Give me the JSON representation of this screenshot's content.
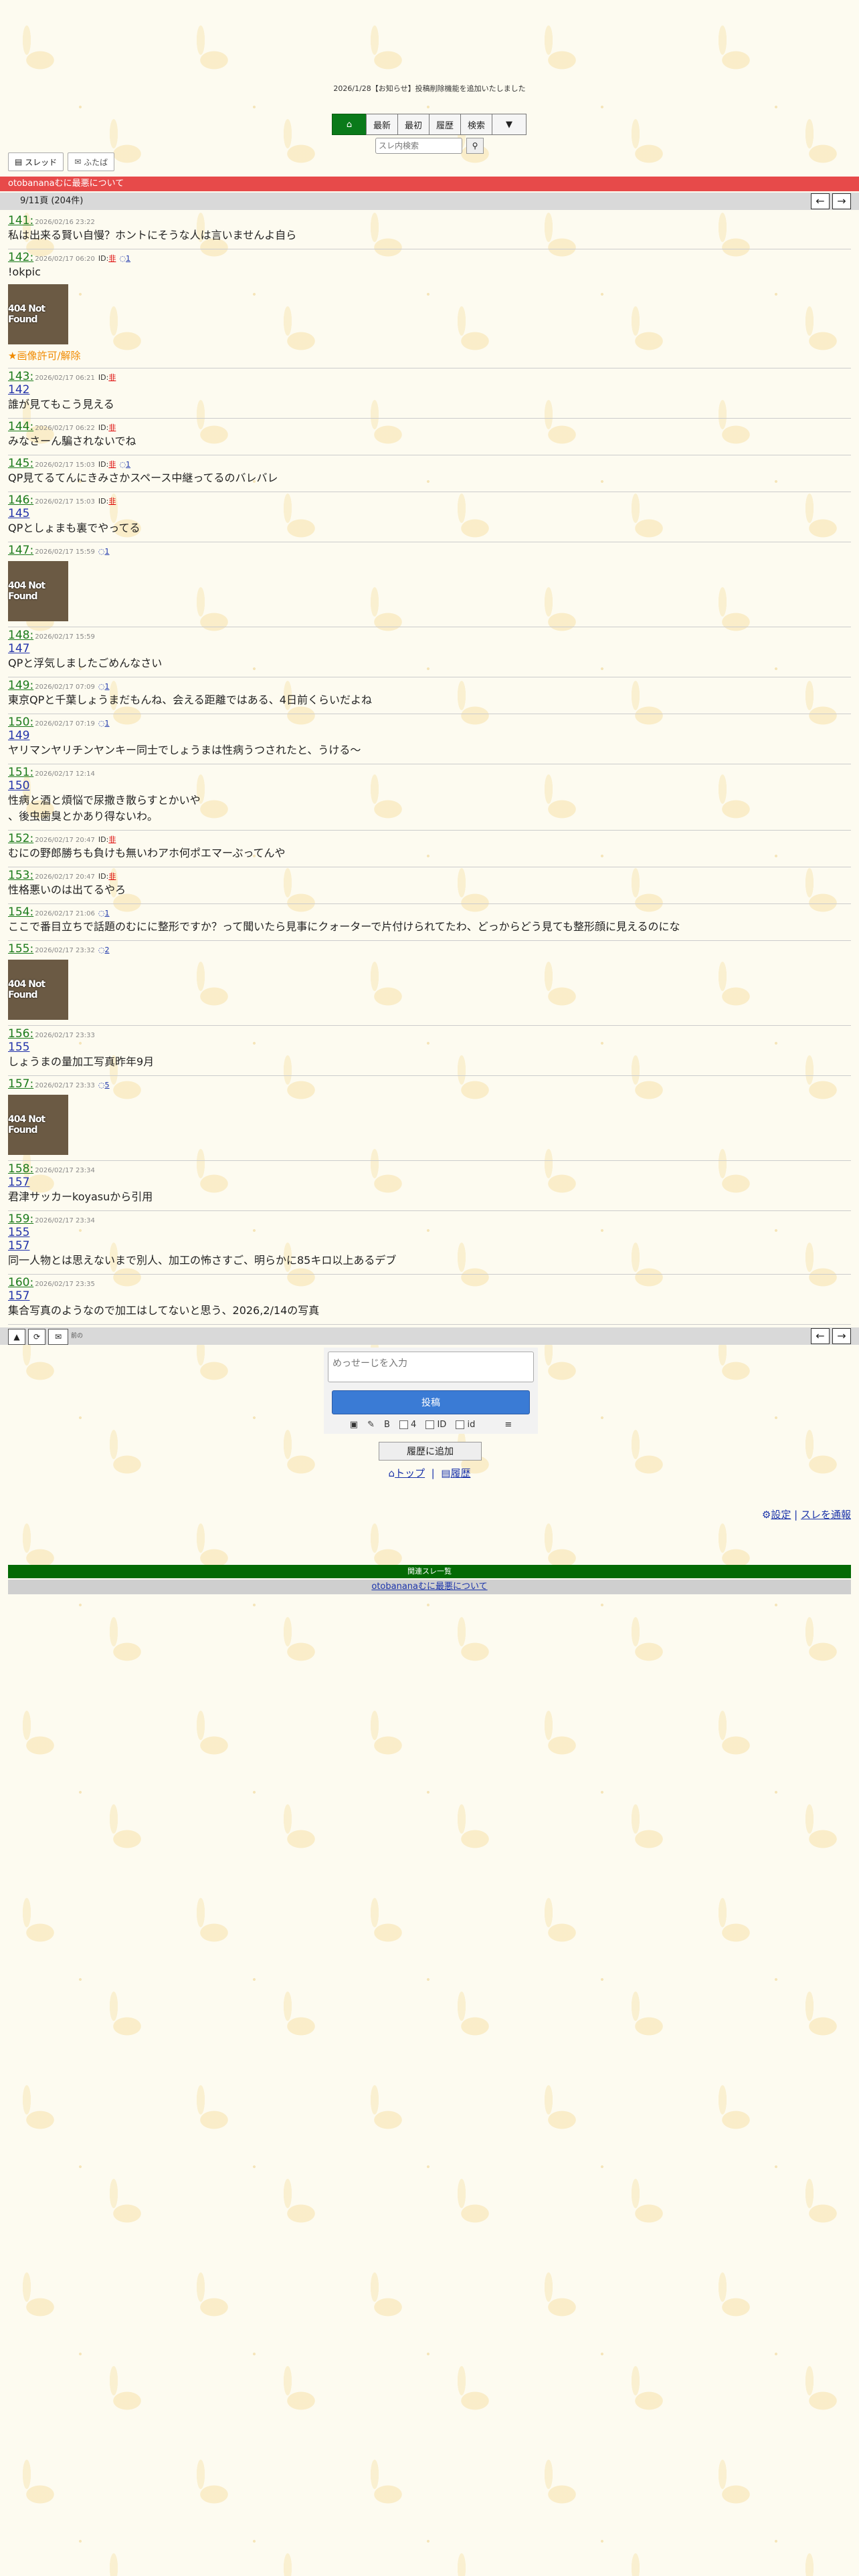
{
  "notice": "2026/1/28【お知らせ】投稿削除機能を追加いたしました",
  "nav": {
    "latest": "最新",
    "first": "最初",
    "history": "履歴",
    "search": "検索",
    "more": "▼"
  },
  "search": {
    "placeholder": "スレ内検索"
  },
  "subnav": {
    "thread": "スレッド",
    "board": "ふたば"
  },
  "thread": {
    "title": "otobananaむに最悪について",
    "page_info": "9/11頁 (204件)"
  },
  "posts": [
    {
      "num": "141:",
      "date": "2026/02/16 23:22",
      "body": "私は出来る賢い自慢？ホントにそうな人は言いませんよ自ら"
    },
    {
      "num": "142:",
      "date": "2026/02/17 06:20",
      "id": "ID:",
      "idv": "非",
      "comments": "1",
      "body": "!okpic",
      "image": "404 Not Found",
      "imgnote": "★画像許可/解除"
    },
    {
      "num": "143:",
      "date": "2026/02/17 06:21",
      "id": "ID:",
      "idv": "非",
      "anchor": "142",
      "body": "誰が見てもこう見える"
    },
    {
      "num": "144:",
      "date": "2026/02/17 06:22",
      "id": "ID:",
      "idv": "非",
      "body": "みなさーん騙されないでね"
    },
    {
      "num": "145:",
      "date": "2026/02/17 15:03",
      "id": "ID:",
      "idv": "非",
      "comments": "1",
      "body": "QP見てるてんにきみさかスペース中継ってるのバレバレ"
    },
    {
      "num": "146:",
      "date": "2026/02/17 15:03",
      "id": "ID:",
      "idv": "非",
      "anchor": "145",
      "body": "QPとしょまも裏でやってる"
    },
    {
      "num": "147:",
      "date": "2026/02/17 15:59",
      "comments": "1",
      "image": "404 Not Found"
    },
    {
      "num": "148:",
      "date": "2026/02/17 15:59",
      "anchor": "147",
      "body": "QPと浮気しましたごめんなさい"
    },
    {
      "num": "149:",
      "date": "2026/02/17 07:09",
      "comments": "1",
      "body": "東京QPと千葉しょうまだもんね、会える距離ではある、4日前くらいだよね"
    },
    {
      "num": "150:",
      "date": "2026/02/17 07:19",
      "comments": "1",
      "anchor": "149",
      "body": "ヤリマンヤリチンヤンキー同士でしょうまは性病うつされたと、うける〜"
    },
    {
      "num": "151:",
      "date": "2026/02/17 12:14",
      "anchor": "150",
      "body": "性病と酒と煩悩で尿撒き散らすとかいや\n、後虫歯臭とかあり得ないわ。"
    },
    {
      "num": "152:",
      "date": "2026/02/17 20:47",
      "id": "ID:",
      "idv": "非",
      "body": "むにの野郎勝ちも負けも無いわアホ何ポエマーぶってんや"
    },
    {
      "num": "153:",
      "date": "2026/02/17 20:47",
      "id": "ID:",
      "idv": "非",
      "body": "性格悪いのは出てるやろ"
    },
    {
      "num": "154:",
      "date": "2026/02/17 21:06",
      "comments": "1",
      "body": "ここで番目立ちで話題のむにに整形ですか？って聞いたら見事にクォーターで片付けられてたわ、どっからどう見ても整形顔に見えるのにな"
    },
    {
      "num": "155:",
      "date": "2026/02/17 23:32",
      "comments": "2",
      "image": "404 Not Found"
    },
    {
      "num": "156:",
      "date": "2026/02/17 23:33",
      "anchor": "155",
      "body": "しょうまの量加工写真昨年9月"
    },
    {
      "num": "157:",
      "date": "2026/02/17 23:33",
      "comments": "5",
      "image": "404 Not Found"
    },
    {
      "num": "158:",
      "date": "2026/02/17 23:34",
      "anchor": "157",
      "body": "君津サッカーkoyasuから引用"
    },
    {
      "num": "159:",
      "date": "2026/02/17 23:34",
      "anchor": "155",
      "anchor2": "157",
      "body": "同一人物とは思えないまで別人、加工の怖さすご、明らかに85キロ以上あるデブ"
    },
    {
      "num": "160:",
      "date": "2026/02/17 23:35",
      "anchor": "157",
      "body": "集合写真のようなので加工はしてないと思う、2026,2/14の写真"
    }
  ],
  "bottom": {
    "refresh_label": "前の",
    "arrows": [
      "←",
      "→"
    ]
  },
  "form": {
    "placeholder": "めっせーじを入力",
    "submit": "投稿",
    "opt1": "4",
    "opt2": "ID",
    "opt3": "id",
    "menu": "≡"
  },
  "history_add": "履歴に追加",
  "links": {
    "top": "トップ",
    "sep": "|",
    "history": "履歴",
    "settings": "設定",
    "sep2": "|",
    "report": "スレを通報"
  },
  "related": {
    "title": "関連スレ一覧",
    "item": "otobananaむに最悪について"
  },
  "colors": {
    "title_bar": "#e74a4a",
    "home_btn": "#0a7a1a",
    "post_num": "#1a7a1a",
    "related_bar": "#046a04",
    "submit_btn": "#3a7bd5"
  }
}
